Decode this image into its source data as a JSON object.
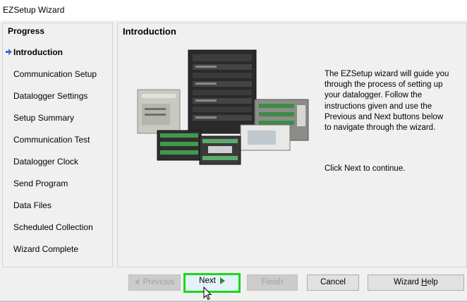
{
  "window": {
    "title": "EZSetup Wizard"
  },
  "progress": {
    "heading": "Progress",
    "steps": [
      {
        "label": "Introduction",
        "active": true
      },
      {
        "label": "Communication Setup"
      },
      {
        "label": "Datalogger Settings"
      },
      {
        "label": "Setup Summary"
      },
      {
        "label": "Communication Test"
      },
      {
        "label": "Datalogger Clock"
      },
      {
        "label": "Send Program"
      },
      {
        "label": "Data Files"
      },
      {
        "label": "Scheduled Collection"
      },
      {
        "label": "Wizard Complete"
      }
    ]
  },
  "content": {
    "heading": "Introduction",
    "description": "The EZSetup wizard will guide you through the process of setting up your datalogger. Follow the instructions given and use the Previous and Next buttons below to navigate through the wizard.",
    "continue_text": "Click Next to continue."
  },
  "buttons": {
    "previous": "Previous",
    "next": "Next",
    "finish": "Finish",
    "cancel": "Cancel",
    "help_prefix": "Wizard ",
    "help_accel": "H",
    "help_suffix": "elp"
  },
  "colors": {
    "highlight": "#19d919",
    "next_arrow": "#2e8b2e",
    "active_arrow": "#3a6fd8"
  }
}
